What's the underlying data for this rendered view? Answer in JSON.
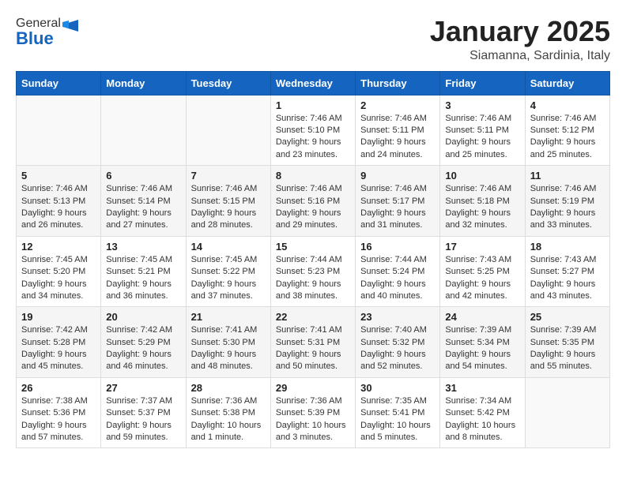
{
  "header": {
    "logo_general": "General",
    "logo_blue": "Blue",
    "month_title": "January 2025",
    "location": "Siamanna, Sardinia, Italy"
  },
  "weekdays": [
    "Sunday",
    "Monday",
    "Tuesday",
    "Wednesday",
    "Thursday",
    "Friday",
    "Saturday"
  ],
  "weeks": [
    [
      {
        "day": "",
        "info": ""
      },
      {
        "day": "",
        "info": ""
      },
      {
        "day": "",
        "info": ""
      },
      {
        "day": "1",
        "info": "Sunrise: 7:46 AM\nSunset: 5:10 PM\nDaylight: 9 hours\nand 23 minutes."
      },
      {
        "day": "2",
        "info": "Sunrise: 7:46 AM\nSunset: 5:11 PM\nDaylight: 9 hours\nand 24 minutes."
      },
      {
        "day": "3",
        "info": "Sunrise: 7:46 AM\nSunset: 5:11 PM\nDaylight: 9 hours\nand 25 minutes."
      },
      {
        "day": "4",
        "info": "Sunrise: 7:46 AM\nSunset: 5:12 PM\nDaylight: 9 hours\nand 25 minutes."
      }
    ],
    [
      {
        "day": "5",
        "info": "Sunrise: 7:46 AM\nSunset: 5:13 PM\nDaylight: 9 hours\nand 26 minutes."
      },
      {
        "day": "6",
        "info": "Sunrise: 7:46 AM\nSunset: 5:14 PM\nDaylight: 9 hours\nand 27 minutes."
      },
      {
        "day": "7",
        "info": "Sunrise: 7:46 AM\nSunset: 5:15 PM\nDaylight: 9 hours\nand 28 minutes."
      },
      {
        "day": "8",
        "info": "Sunrise: 7:46 AM\nSunset: 5:16 PM\nDaylight: 9 hours\nand 29 minutes."
      },
      {
        "day": "9",
        "info": "Sunrise: 7:46 AM\nSunset: 5:17 PM\nDaylight: 9 hours\nand 31 minutes."
      },
      {
        "day": "10",
        "info": "Sunrise: 7:46 AM\nSunset: 5:18 PM\nDaylight: 9 hours\nand 32 minutes."
      },
      {
        "day": "11",
        "info": "Sunrise: 7:46 AM\nSunset: 5:19 PM\nDaylight: 9 hours\nand 33 minutes."
      }
    ],
    [
      {
        "day": "12",
        "info": "Sunrise: 7:45 AM\nSunset: 5:20 PM\nDaylight: 9 hours\nand 34 minutes."
      },
      {
        "day": "13",
        "info": "Sunrise: 7:45 AM\nSunset: 5:21 PM\nDaylight: 9 hours\nand 36 minutes."
      },
      {
        "day": "14",
        "info": "Sunrise: 7:45 AM\nSunset: 5:22 PM\nDaylight: 9 hours\nand 37 minutes."
      },
      {
        "day": "15",
        "info": "Sunrise: 7:44 AM\nSunset: 5:23 PM\nDaylight: 9 hours\nand 38 minutes."
      },
      {
        "day": "16",
        "info": "Sunrise: 7:44 AM\nSunset: 5:24 PM\nDaylight: 9 hours\nand 40 minutes."
      },
      {
        "day": "17",
        "info": "Sunrise: 7:43 AM\nSunset: 5:25 PM\nDaylight: 9 hours\nand 42 minutes."
      },
      {
        "day": "18",
        "info": "Sunrise: 7:43 AM\nSunset: 5:27 PM\nDaylight: 9 hours\nand 43 minutes."
      }
    ],
    [
      {
        "day": "19",
        "info": "Sunrise: 7:42 AM\nSunset: 5:28 PM\nDaylight: 9 hours\nand 45 minutes."
      },
      {
        "day": "20",
        "info": "Sunrise: 7:42 AM\nSunset: 5:29 PM\nDaylight: 9 hours\nand 46 minutes."
      },
      {
        "day": "21",
        "info": "Sunrise: 7:41 AM\nSunset: 5:30 PM\nDaylight: 9 hours\nand 48 minutes."
      },
      {
        "day": "22",
        "info": "Sunrise: 7:41 AM\nSunset: 5:31 PM\nDaylight: 9 hours\nand 50 minutes."
      },
      {
        "day": "23",
        "info": "Sunrise: 7:40 AM\nSunset: 5:32 PM\nDaylight: 9 hours\nand 52 minutes."
      },
      {
        "day": "24",
        "info": "Sunrise: 7:39 AM\nSunset: 5:34 PM\nDaylight: 9 hours\nand 54 minutes."
      },
      {
        "day": "25",
        "info": "Sunrise: 7:39 AM\nSunset: 5:35 PM\nDaylight: 9 hours\nand 55 minutes."
      }
    ],
    [
      {
        "day": "26",
        "info": "Sunrise: 7:38 AM\nSunset: 5:36 PM\nDaylight: 9 hours\nand 57 minutes."
      },
      {
        "day": "27",
        "info": "Sunrise: 7:37 AM\nSunset: 5:37 PM\nDaylight: 9 hours\nand 59 minutes."
      },
      {
        "day": "28",
        "info": "Sunrise: 7:36 AM\nSunset: 5:38 PM\nDaylight: 10 hours\nand 1 minute."
      },
      {
        "day": "29",
        "info": "Sunrise: 7:36 AM\nSunset: 5:39 PM\nDaylight: 10 hours\nand 3 minutes."
      },
      {
        "day": "30",
        "info": "Sunrise: 7:35 AM\nSunset: 5:41 PM\nDaylight: 10 hours\nand 5 minutes."
      },
      {
        "day": "31",
        "info": "Sunrise: 7:34 AM\nSunset: 5:42 PM\nDaylight: 10 hours\nand 8 minutes."
      },
      {
        "day": "",
        "info": ""
      }
    ]
  ]
}
